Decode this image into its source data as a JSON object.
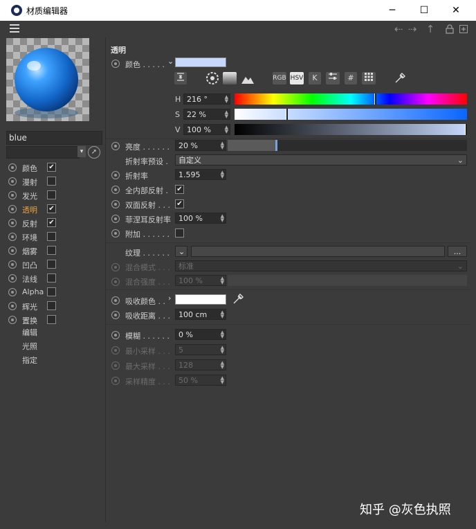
{
  "window": {
    "title": "材质编辑器",
    "minimize": "─",
    "maximize": "☐",
    "close": "✕"
  },
  "toolbar": {
    "menu_icon": "hamburger-icon",
    "icons": [
      "arrow-left-icon",
      "arrow-right-icon",
      "arrow-up-icon",
      "lock-icon",
      "new-window-icon"
    ]
  },
  "material": {
    "name": "blue"
  },
  "channels": [
    {
      "label": "颜色",
      "checked": true,
      "active": false
    },
    {
      "label": "漫射",
      "checked": false,
      "active": false
    },
    {
      "label": "发光",
      "checked": false,
      "active": false
    },
    {
      "label": "透明",
      "checked": true,
      "active": true
    },
    {
      "label": "反射",
      "checked": true,
      "active": false
    },
    {
      "label": "环境",
      "checked": false,
      "active": false
    },
    {
      "label": "烟雾",
      "checked": false,
      "active": false
    },
    {
      "label": "凹凸",
      "checked": false,
      "active": false
    },
    {
      "label": "法线",
      "checked": false,
      "active": false
    },
    {
      "label": "Alpha",
      "checked": false,
      "active": false
    },
    {
      "label": "辉光",
      "checked": false,
      "active": false
    },
    {
      "label": "置换",
      "checked": false,
      "active": false
    }
  ],
  "sublinks": [
    "编辑",
    "光照",
    "指定"
  ],
  "section": {
    "title": "透明"
  },
  "color": {
    "label": "颜色 . . . . .",
    "swatch": "#c6d8fb",
    "modes": [
      "RGB",
      "HSV",
      "K"
    ],
    "mode_symbols": [
      "#"
    ],
    "H": {
      "label": "H",
      "value": "216 °"
    },
    "S": {
      "label": "S",
      "value": "22 %"
    },
    "V": {
      "label": "V",
      "value": "100 %"
    },
    "h_fraction": 0.6,
    "s_fraction": 0.22,
    "v_fraction": 1.0
  },
  "brightness": {
    "label": "亮度 . . . . . .",
    "value": "20 %",
    "fraction": 0.2
  },
  "ior_preset": {
    "label": "折射率预设 .",
    "value": "自定义"
  },
  "ior": {
    "label": "折射率",
    "value": "1.595"
  },
  "total_internal_reflection": {
    "label": "全内部反射 .",
    "checked": true
  },
  "double_sided_reflection": {
    "label": "双面反射 . . .",
    "checked": true
  },
  "fresnel": {
    "label": "菲涅耳反射率",
    "value": "100 %"
  },
  "additive": {
    "label": "附加 . . . . . .",
    "checked": false
  },
  "texture": {
    "label": "纹理 . . . . . .",
    "button": "..."
  },
  "blend_mode": {
    "label": "混合模式 . . .",
    "value": "标准"
  },
  "blend_strength": {
    "label": "混合强度 . . .",
    "value": "100 %"
  },
  "absorption_color": {
    "label": "吸收颜色 . .",
    "swatch": "#ffffff"
  },
  "absorption_distance": {
    "label": "吸收距离 . . .",
    "value": "100 cm"
  },
  "blur": {
    "label": "模糊 . . . . . .",
    "value": "0 %"
  },
  "min_samples": {
    "label": "最小采样 . . .",
    "value": "5"
  },
  "max_samples": {
    "label": "最大采样 . . .",
    "value": "128"
  },
  "sample_accuracy": {
    "label": "采样精度 . . .",
    "value": "50 %"
  },
  "watermark": "知乎 @灰色执照"
}
